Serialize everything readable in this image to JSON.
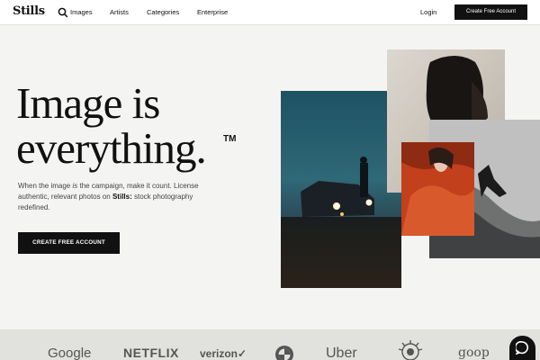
{
  "header": {
    "logo": "Stills",
    "nav": [
      "Images",
      "Artists",
      "Categories",
      "Enterprise"
    ],
    "login": "Login",
    "cta": "Create Free Account"
  },
  "hero": {
    "title_line1": "Image is",
    "title_line2": "everything.",
    "trademark": "TM",
    "sub_1": "When the image ",
    "sub_em": "is",
    "sub_2": " the campaign, make it count. License authentic, relevant photos on ",
    "sub_brand": "Stills:",
    "sub_3": " stock photography redefined.",
    "cta": "CREATE FREE ACCOUNT"
  },
  "logos": [
    "Google",
    "NETFLIX",
    "verizon✓",
    "Uber",
    "goop"
  ],
  "icons": {
    "search": "search-icon",
    "chat": "chat-icon",
    "bmw": "bmw-logo",
    "seal": "seal-logo"
  },
  "colors": {
    "background": "#f4f4f2",
    "dark": "#111111",
    "logo_band": "#e1e1dd",
    "accent_red": "#c3401c"
  }
}
